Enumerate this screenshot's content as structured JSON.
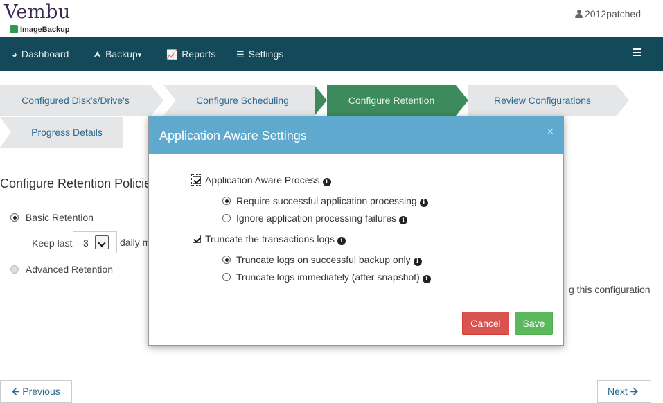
{
  "header": {
    "logo_text": "Vembu",
    "logo_sub": "ImageBackup",
    "user": "2012patched"
  },
  "nav": {
    "items": [
      {
        "label": "Dashboard",
        "icon": "pie-chart-icon"
      },
      {
        "label": "Backup",
        "icon": "upload-icon",
        "caret": "▾"
      },
      {
        "label": "Reports",
        "icon": "line-chart-icon"
      },
      {
        "label": "Settings",
        "icon": "sliders-icon"
      }
    ],
    "menu_icon": "hamburger-icon"
  },
  "wizard": {
    "steps": [
      {
        "label": "Configured Disk's/Drive's",
        "active": false
      },
      {
        "label": "Configure Scheduling",
        "active": false
      },
      {
        "label": "Configure Retention",
        "active": true
      },
      {
        "label": "Review Configurations",
        "active": false
      },
      {
        "label": "Progress Details",
        "active": false
      }
    ]
  },
  "page": {
    "title": "Configure Retention Policie",
    "basic_retention": "Basic Retention",
    "keep_last": "Keep last",
    "keep_value": "3",
    "daily_text": "daily m",
    "advanced_retention": "Advanced Retention",
    "config_text": "g this configuration",
    "previous": "Previous",
    "next": "Next"
  },
  "modal": {
    "title": "Application Aware Settings",
    "close": "×",
    "app_aware": {
      "label": "Application Aware Process",
      "checked": true
    },
    "app_options": [
      {
        "label": "Require successful application processing",
        "selected": true
      },
      {
        "label": "Ignore application processing failures",
        "selected": false
      }
    ],
    "truncate": {
      "label": "Truncate the transactions logs",
      "checked": true
    },
    "truncate_options": [
      {
        "label": "Truncate logs on successful backup only",
        "selected": true
      },
      {
        "label": "Truncate logs immediately (after snapshot)",
        "selected": false
      }
    ],
    "cancel": "Cancel",
    "save": "Save"
  },
  "colors": {
    "navbar": "#14495a",
    "active_step": "#3d8b5c",
    "modal_header": "#5ea9cd",
    "cancel": "#d9534f",
    "save": "#5cb85c"
  }
}
